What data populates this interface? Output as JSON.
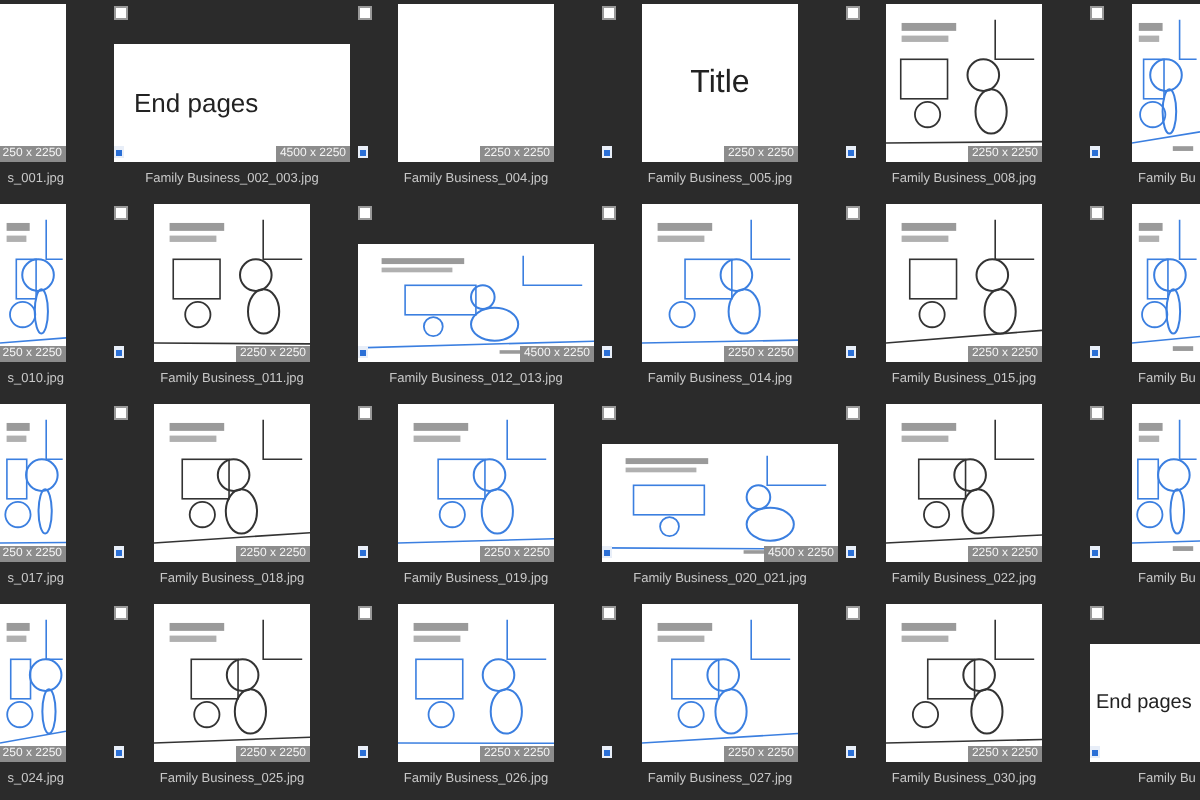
{
  "rows": [
    {
      "left": {
        "name": "s_001.jpg",
        "size": "250 x 2250",
        "kind": "blank"
      },
      "items": [
        {
          "name": "Family Business_002_003.jpg",
          "size": "4500 x 2250",
          "landscape": true,
          "kind": "text",
          "text": "End pages",
          "checked": false
        },
        {
          "name": "Family Business_004.jpg",
          "size": "2250 x 2250",
          "landscape": false,
          "kind": "blank",
          "checked": false
        },
        {
          "name": "Family Business_005.jpg",
          "size": "2250 x 2250",
          "landscape": false,
          "kind": "title",
          "text": "Title",
          "checked": false
        },
        {
          "name": "Family Business_008.jpg",
          "size": "2250 x 2250",
          "landscape": false,
          "kind": "picture",
          "checked": false
        }
      ],
      "right": {
        "name": "Family Bu",
        "landscape": false,
        "kind": "picture",
        "checked": false
      }
    },
    {
      "left": {
        "name": "s_010.jpg",
        "size": "250 x 2250",
        "kind": "picture"
      },
      "items": [
        {
          "name": "Family Business_011.jpg",
          "size": "2250 x 2250",
          "landscape": false,
          "kind": "picture",
          "checked": false
        },
        {
          "name": "Family Business_012_013.jpg",
          "size": "4500 x 2250",
          "landscape": true,
          "kind": "picture",
          "checked": false
        },
        {
          "name": "Family Business_014.jpg",
          "size": "2250 x 2250",
          "landscape": false,
          "kind": "picture",
          "checked": false
        },
        {
          "name": "Family Business_015.jpg",
          "size": "2250 x 2250",
          "landscape": false,
          "kind": "picture",
          "checked": false
        }
      ],
      "right": {
        "name": "Family Bu",
        "landscape": false,
        "kind": "picture",
        "checked": false
      }
    },
    {
      "left": {
        "name": "s_017.jpg",
        "size": "250 x 2250",
        "kind": "picture"
      },
      "items": [
        {
          "name": "Family Business_018.jpg",
          "size": "2250 x 2250",
          "landscape": false,
          "kind": "picture",
          "checked": false
        },
        {
          "name": "Family Business_019.jpg",
          "size": "2250 x 2250",
          "landscape": false,
          "kind": "picture",
          "checked": false
        },
        {
          "name": "Family Business_020_021.jpg",
          "size": "4500 x 2250",
          "landscape": true,
          "kind": "picture",
          "checked": false
        },
        {
          "name": "Family Business_022.jpg",
          "size": "2250 x 2250",
          "landscape": false,
          "kind": "picture",
          "checked": false
        }
      ],
      "right": {
        "name": "Family Bu",
        "landscape": false,
        "kind": "picture",
        "checked": false
      }
    },
    {
      "left": {
        "name": "s_024.jpg",
        "size": "250 x 2250",
        "kind": "picture"
      },
      "items": [
        {
          "name": "Family Business_025.jpg",
          "size": "2250 x 2250",
          "landscape": false,
          "kind": "picture",
          "checked": false
        },
        {
          "name": "Family Business_026.jpg",
          "size": "2250 x 2250",
          "landscape": false,
          "kind": "picture",
          "checked": false
        },
        {
          "name": "Family Business_027.jpg",
          "size": "2250 x 2250",
          "landscape": false,
          "kind": "picture",
          "checked": false
        },
        {
          "name": "Family Business_030.jpg",
          "size": "2250 x 2250",
          "landscape": false,
          "kind": "picture",
          "checked": false
        }
      ],
      "right": {
        "name": "Family Bu",
        "landscape": true,
        "kind": "text",
        "text": "End pages",
        "checked": false
      }
    }
  ]
}
